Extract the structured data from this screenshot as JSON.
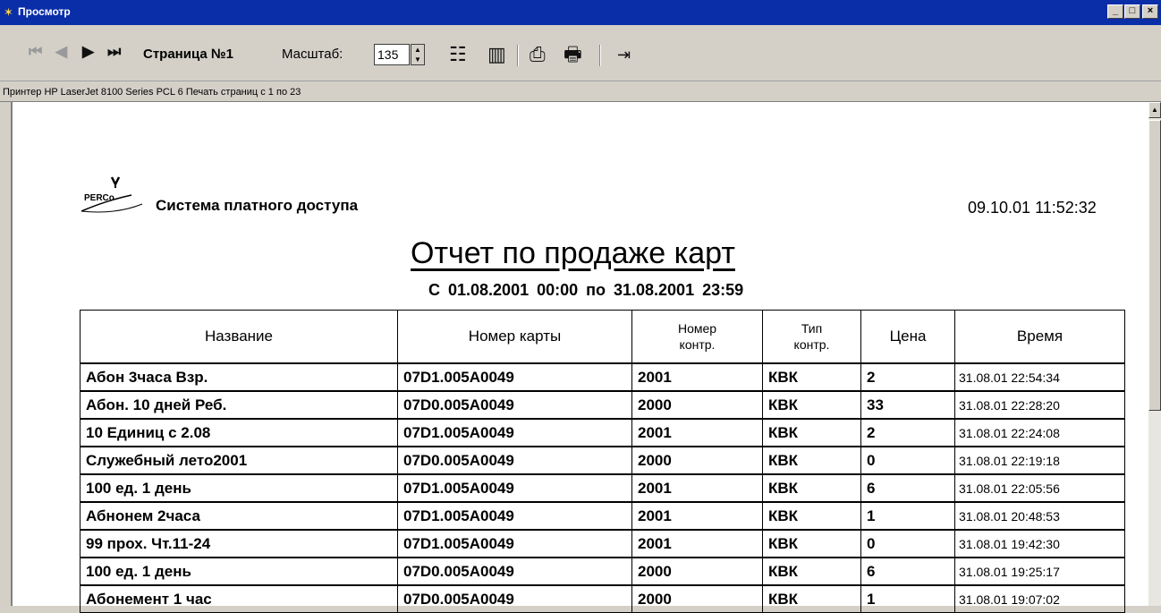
{
  "window": {
    "title": "Просмотр"
  },
  "toolbar": {
    "page_label": "Страница №1",
    "zoom_label": "Масштаб:",
    "zoom_value": "135"
  },
  "status": {
    "text": "Принтер HP LaserJet 8100 Series PCL 6  Печать страниц с 1 по 23"
  },
  "report": {
    "company": "Система платного доступа",
    "datetime": "09.10.01 11:52:32",
    "title": "Отчет по продаже карт",
    "range": "С 01.08.2001  00:00  по  31.08.2001  23:59",
    "columns": [
      "Название",
      "Номер карты",
      "Номер\nконтр.",
      "Тип\nконтр.",
      "Цена",
      "Время"
    ],
    "rows": [
      [
        "Абон 3часа Взр.",
        "07D1.005A0049",
        "2001",
        "КВК",
        "2",
        "31.08.01 22:54:34"
      ],
      [
        "Абон. 10 дней Реб.",
        "07D0.005A0049",
        "2000",
        "КВК",
        "33",
        "31.08.01 22:28:20"
      ],
      [
        "10 Единиц с 2.08",
        "07D1.005A0049",
        "2001",
        "КВК",
        "2",
        "31.08.01 22:24:08"
      ],
      [
        "Служебный лето2001",
        "07D0.005A0049",
        "2000",
        "КВК",
        "0",
        "31.08.01 22:19:18"
      ],
      [
        "100 ед. 1 день",
        "07D1.005A0049",
        "2001",
        "КВК",
        "6",
        "31.08.01 22:05:56"
      ],
      [
        "Абнонем 2часа",
        "07D1.005A0049",
        "2001",
        "КВК",
        "1",
        "31.08.01 20:48:53"
      ],
      [
        "99 прох. Чт.11-24",
        "07D1.005A0049",
        "2001",
        "КВК",
        "0",
        "31.08.01 19:42:30"
      ],
      [
        "100 ед. 1 день",
        "07D0.005A0049",
        "2000",
        "КВК",
        "6",
        "31.08.01 19:25:17"
      ],
      [
        "Абонемент 1 час",
        "07D0.005A0049",
        "2000",
        "КВК",
        "1",
        "31.08.01 19:07:02"
      ]
    ]
  },
  "icons": {
    "first": "first-page-icon",
    "prev": "prev-page-icon",
    "next": "next-page-icon",
    "last": "last-page-icon",
    "setup": "page-setup-icon",
    "columns": "columns-icon",
    "print_setup": "printer-setup-icon",
    "print": "print-icon",
    "exit": "exit-icon"
  },
  "colors": {
    "titlebar": "#0a2ea8",
    "chrome": "#d4d0c8"
  }
}
